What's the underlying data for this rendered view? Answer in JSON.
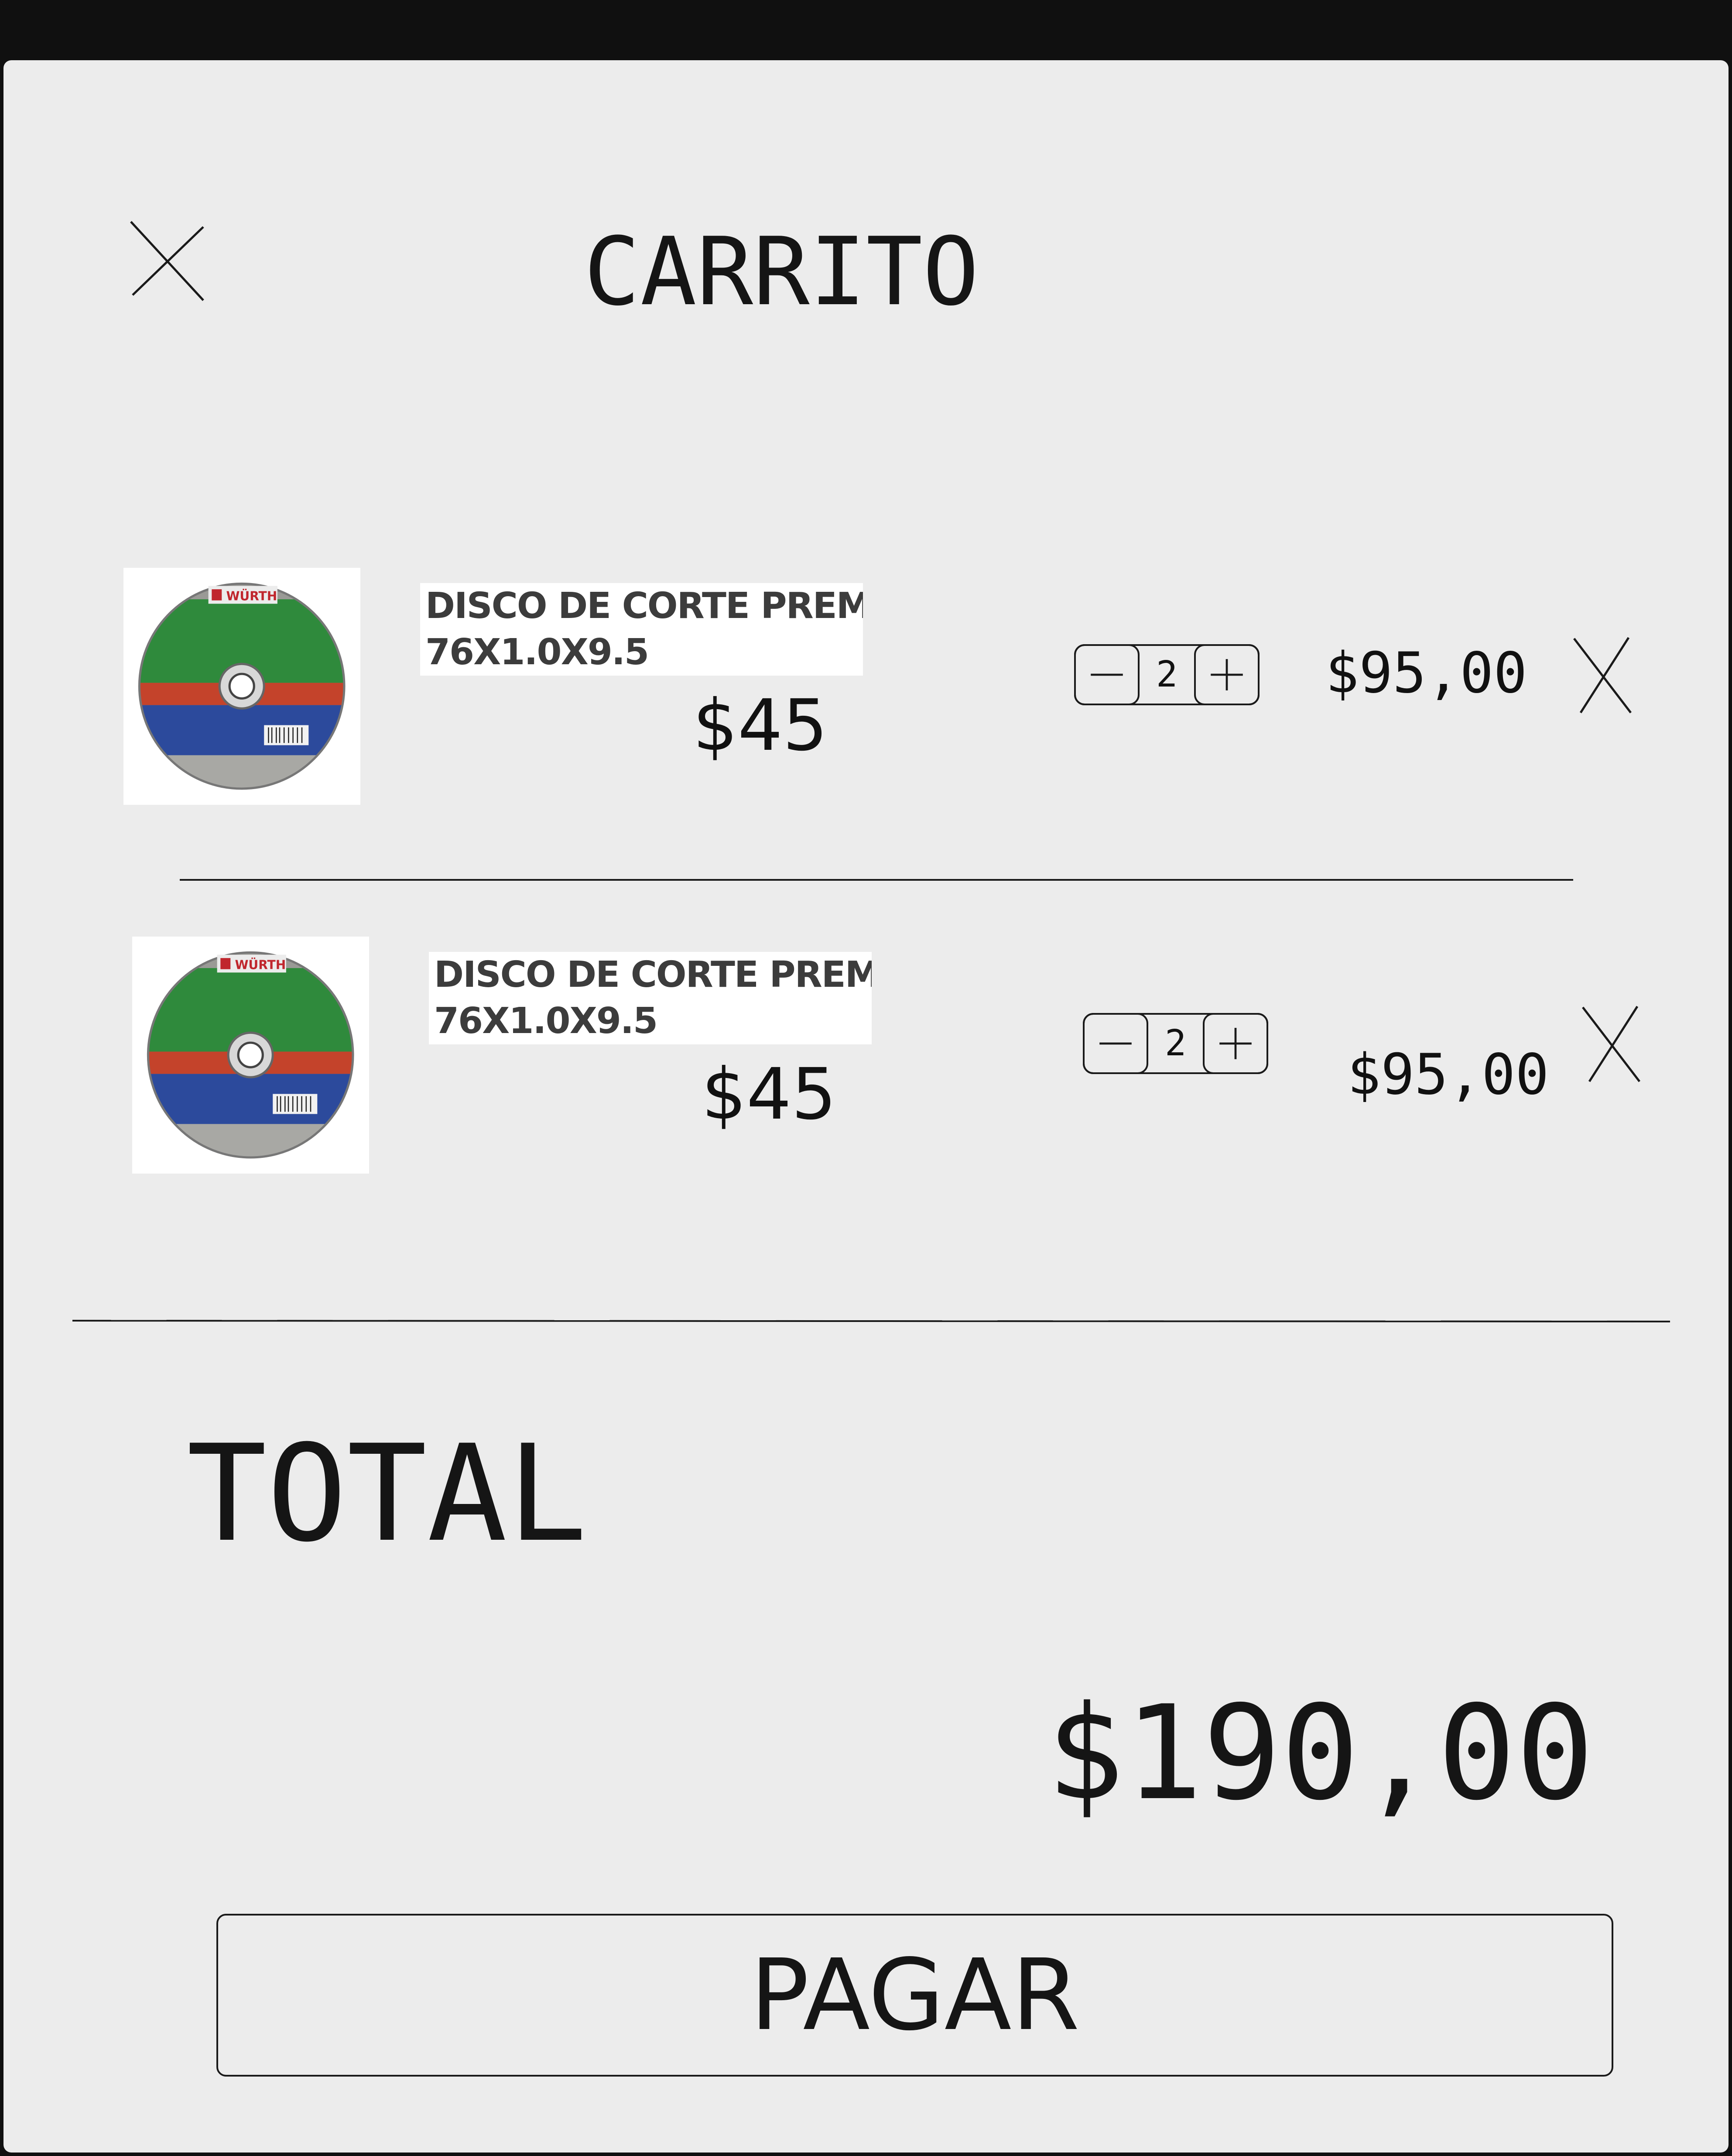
{
  "cart": {
    "title": "CARRITO",
    "close_icon": "close-icon",
    "items": [
      {
        "image_icon": "cutting-disc-image",
        "image_brand": "WÜRTH",
        "name_line1": "DISCO DE CORTE PREMIUM",
        "name_line2": "76X1.0X9.5",
        "unit_price": "$45",
        "quantity": "2",
        "line_total": "$95,00",
        "remove_icon": "remove-x-icon"
      },
      {
        "image_icon": "cutting-disc-image",
        "image_brand": "WÜRTH",
        "name_line1": "DISCO DE CORTE PREMIUM",
        "name_line2": "76X1.0X9.5",
        "unit_price": "$45",
        "quantity": "2",
        "line_total": "$95,00",
        "remove_icon": "remove-x-icon"
      }
    ],
    "total_label": "TOTAL",
    "total_value": "$190,00",
    "pay_label": "PAGAR"
  },
  "colors": {
    "page_background": "#101010",
    "panel_background": "#ececec",
    "text": "#151515",
    "disc_green": "#2f8a3c",
    "disc_blue": "#2c4a9c",
    "disc_red": "#c4432b",
    "brand_red": "#c0262d"
  }
}
